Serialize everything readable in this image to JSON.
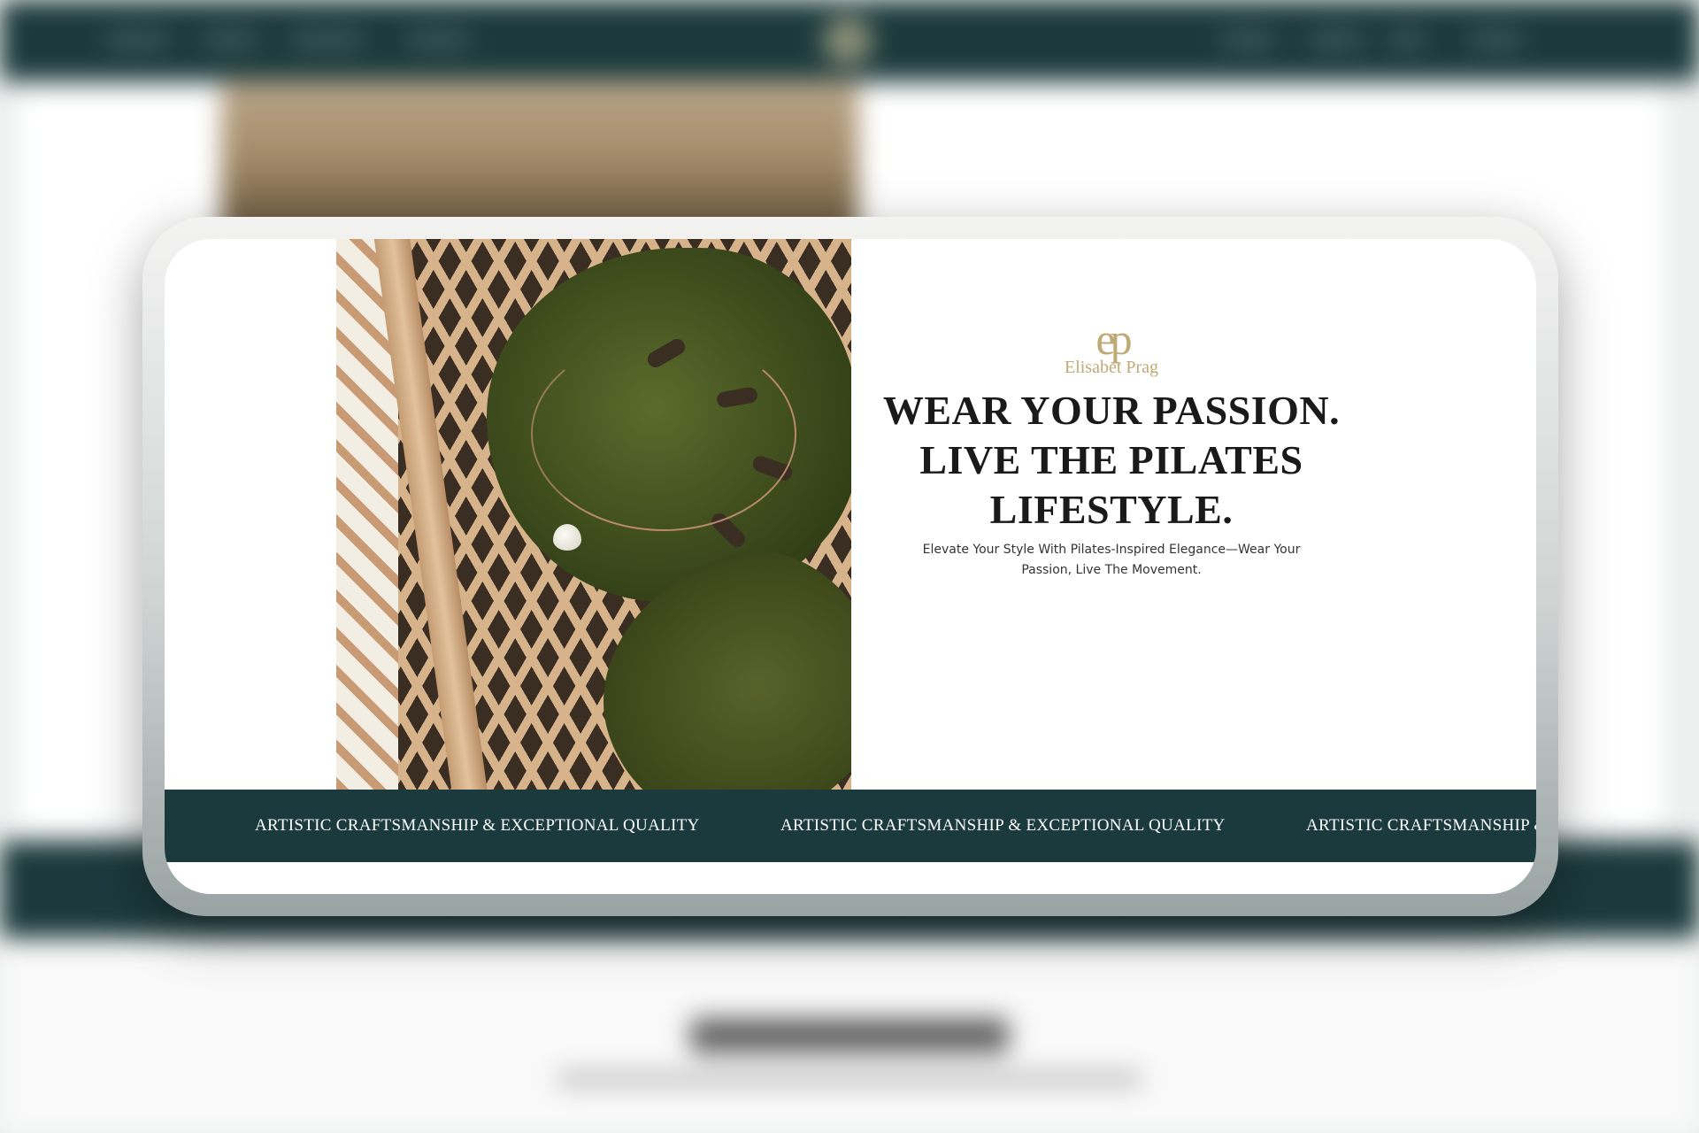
{
  "brand": {
    "monogram": "ep",
    "name": "Elisabet Prag"
  },
  "hero": {
    "headline_lines": [
      "WEAR YOUR PASSION.",
      "LIVE THE PILATES",
      "LIFESTYLE."
    ],
    "subtitle_line1": "Elevate Your Style With Pilates-Inspired Elegance—Wear Your",
    "subtitle_line2": "Passion, Live The Movement."
  },
  "banner": {
    "items": [
      "ARTISTIC CRAFTSMANSHIP & EXCEPTIONAL QUALITY",
      "ARTISTIC CRAFTSMANSHIP & EXCEPTIONAL QUALITY",
      "ARTISTIC CRAFTSMANSHIP & EXCEPTIONAL QUALITY"
    ]
  },
  "photo": {
    "icon": "product-photo-necklace-on-leaf"
  },
  "colors": {
    "banner_bg": "#1b3a3d",
    "brand_gold": "#bfa975",
    "headline": "#1a1a1a"
  }
}
